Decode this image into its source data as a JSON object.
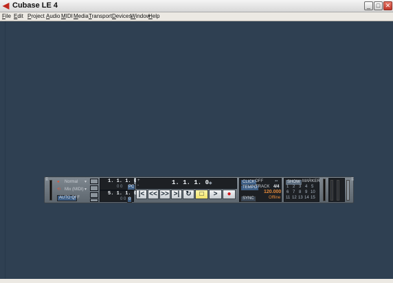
{
  "window": {
    "title": "Cubase LE 4"
  },
  "menubar": [
    "File",
    "Edit",
    "Project",
    "Audio",
    "MIDI",
    "Media",
    "Transport",
    "Devices",
    "Window",
    "Help"
  ],
  "transport": {
    "record_mode": "Normal",
    "cycle_mode": "Mix (MIDI)",
    "auto_q": {
      "label": "AUTO Q",
      "value": "OFF"
    },
    "left_locator": "1. 1. 1.    0",
    "left_locator_sub": "0    0",
    "right_locator": "5. 1. 1.    0",
    "right_locator_sub": "0    0",
    "pre_label": "PC",
    "post_label": "0",
    "position": "1. 1. 1.    0",
    "click": {
      "label": "CLICK",
      "value": "OFF"
    },
    "tempo": {
      "label": "TEMPO",
      "mode": "TRACK",
      "signature": "4/4",
      "bpm": "120.000"
    },
    "sync": {
      "label": "SYNC",
      "status": "Offline"
    },
    "marker": {
      "show_label": "SHOW",
      "title": "MARKER",
      "rows": [
        [
          "1",
          "2",
          "3",
          "4",
          "5"
        ],
        [
          "6",
          "7",
          "8",
          "9",
          "10"
        ],
        [
          "11",
          "12",
          "13",
          "14",
          "15"
        ]
      ]
    },
    "controls": [
      "go-to-start",
      "rewind",
      "fast-forward",
      "go-to-end",
      "cycle",
      "stop",
      "play",
      "record"
    ],
    "control_glyphs": [
      "|<",
      "<<",
      ">>",
      ">|",
      "↻",
      "□",
      ">",
      "●"
    ]
  },
  "colors": {
    "workspace": "#2f4052",
    "record": "#d2161a",
    "stop_active": "#f3e36a",
    "chip_blue": "#3e5f86",
    "tempo_value": "#e58a3a"
  }
}
